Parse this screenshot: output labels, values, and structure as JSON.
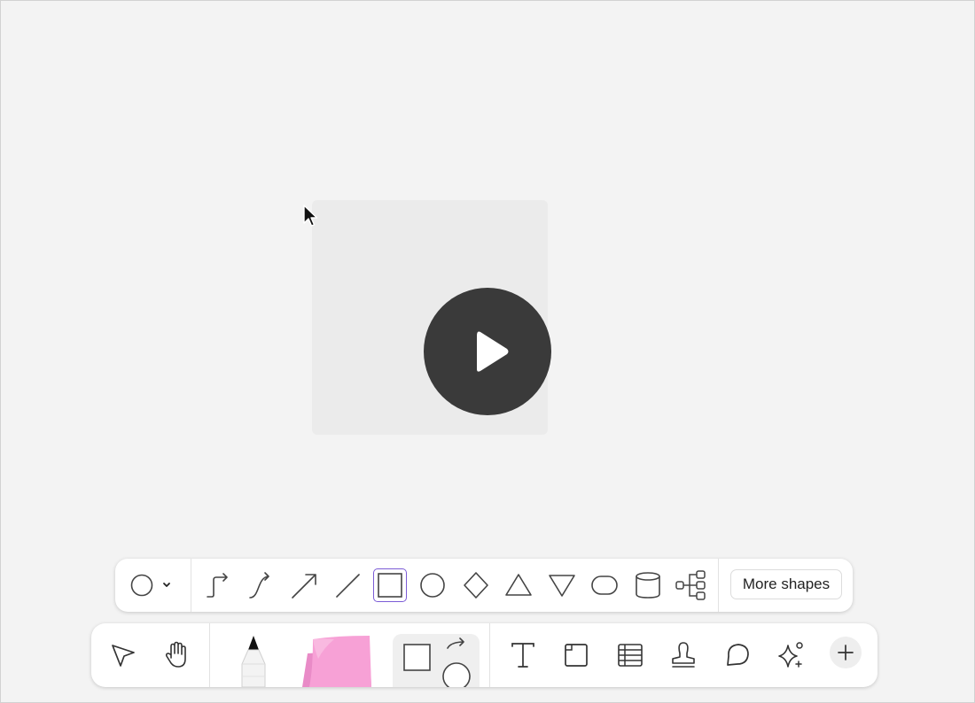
{
  "canvas": {
    "video": {
      "play_icon": "play-icon"
    }
  },
  "shape_toolbar": {
    "shape_picker_icon": "circle-icon",
    "tools": [
      "elbow-connector-icon",
      "curved-connector-icon",
      "arrow-line-icon",
      "straight-line-icon",
      "rectangle-icon",
      "circle-icon",
      "diamond-icon",
      "triangle-icon",
      "inverted-triangle-icon",
      "rounded-rectangle-icon",
      "cylinder-icon",
      "flowchart-icon"
    ],
    "selected_tool": "rectangle-icon",
    "more_shapes_label": "More shapes"
  },
  "main_toolbar": {
    "tools": [
      "select-icon",
      "hand-icon",
      "pen-icon",
      "sticky-note-icon",
      "shapes-icon",
      "text-icon",
      "section-icon",
      "table-icon",
      "stamp-icon",
      "comment-icon",
      "ai-sparkle-icon",
      "plus-icon"
    ]
  },
  "colors": {
    "selection_accent": "#7b5bd6",
    "sticky_note": "#f7a1d6",
    "play_button": "#3a3a3a"
  }
}
